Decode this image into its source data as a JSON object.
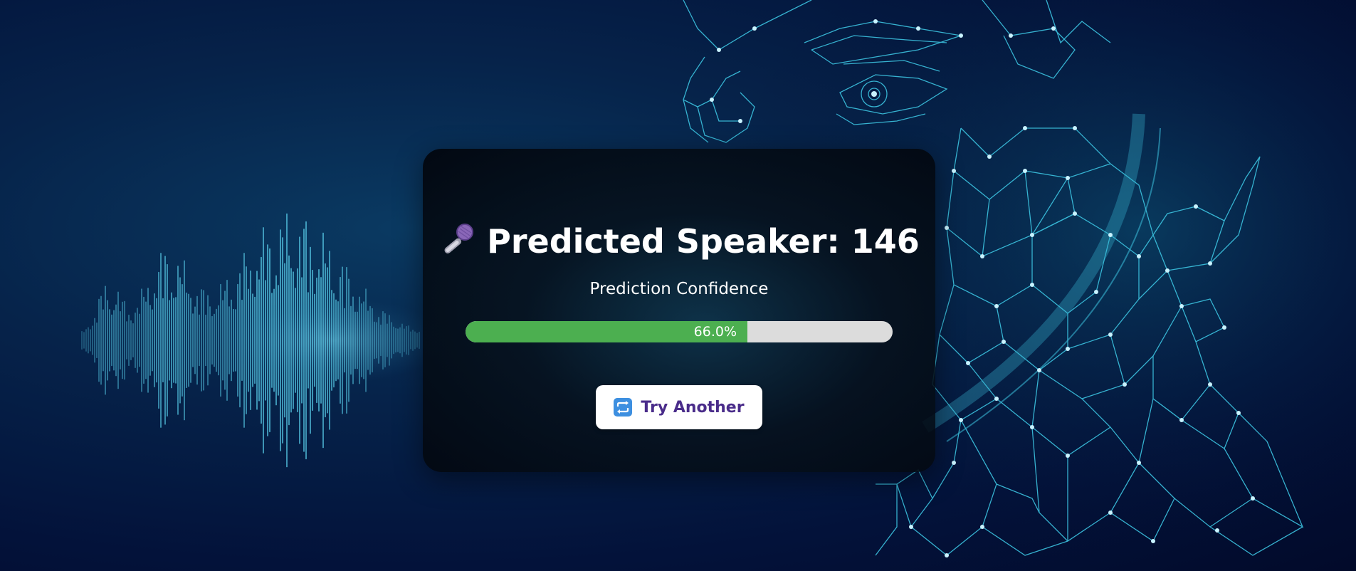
{
  "result": {
    "title_prefix": "Predicted Speaker: ",
    "speaker_id": "146",
    "confidence_heading": "Prediction Confidence",
    "confidence_value": 0.66,
    "confidence_label": "66.0%"
  },
  "actions": {
    "try_another_label": "Try Another"
  },
  "icons": {
    "title_icon": "microphone-icon",
    "button_icon": "repeat-icon"
  },
  "colors": {
    "progress_fill": "#4caf50",
    "progress_track": "#dcdcdc",
    "button_text": "#4a2c8a",
    "accent_cyan": "#2fb6d6"
  }
}
